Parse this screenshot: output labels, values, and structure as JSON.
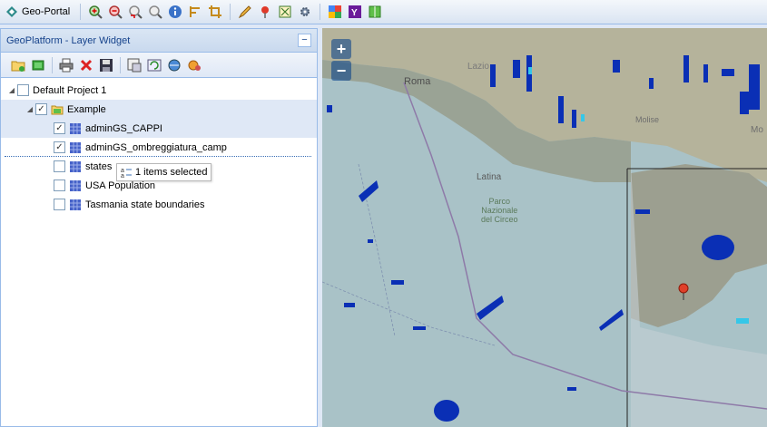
{
  "app": {
    "title": "Geo-Portal"
  },
  "toolbar": {
    "icons": [
      "zoom-in-icon",
      "zoom-out-icon",
      "zoom-previous-icon",
      "zoom-next-icon",
      "info-icon",
      "measure-icon",
      "crop-icon",
      "edit-pencil-icon",
      "map-pin-icon",
      "layer-export-icon",
      "gear-icon",
      "google-icon",
      "yahoo-icon",
      "book-icon"
    ]
  },
  "panel": {
    "title": "GeoPlatform - Layer Widget",
    "collapse_label": "−",
    "toolbar_icons": [
      "add-folder-icon",
      "add-layer-icon",
      "print-icon",
      "delete-icon",
      "save-icon",
      "export-icon",
      "refresh-icon",
      "share-icon",
      "settings-icon"
    ],
    "tree": {
      "project": "Default Project 1",
      "folder": "Example",
      "layers": [
        {
          "label": "adminGS_CAPPI",
          "checked": true
        },
        {
          "label": "adminGS_ombreggiatura_camp",
          "checked": true
        },
        {
          "label": "states",
          "checked": false
        },
        {
          "label": "USA Population",
          "checked": false
        },
        {
          "label": "Tasmania state boundaries",
          "checked": false
        }
      ]
    },
    "drag_tooltip": "1 items selected"
  },
  "map": {
    "zoom_in": "+",
    "zoom_out": "−",
    "labels": {
      "lazio": "Lazio",
      "roma": "Roma",
      "latina": "Latina",
      "parco": "Parco\nNazionale\ndel Circeo",
      "molise": "Molise",
      "mo": "Mo"
    },
    "colors": {
      "sea": "#a7c1c7",
      "land": "#b7b59d",
      "rain": "#0a2fb5"
    }
  }
}
